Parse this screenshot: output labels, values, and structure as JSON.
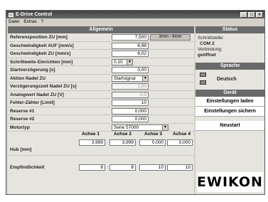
{
  "window": {
    "title": "E-Drive Control"
  },
  "menu": [
    "Datei",
    "Extras",
    "?"
  ],
  "allgemein": {
    "header": "Allgemein",
    "referenzposition": {
      "label": "Referenzposition ZU [mm]",
      "value": "7,500",
      "range": "3mm - 8mm"
    },
    "geschw_auf": {
      "label": "Geschwindigkeit AUF [mm/s]",
      "value": "6,98"
    },
    "geschw_zu": {
      "label": "Geschwindigkeit ZU [mm/s]",
      "value": "6,02"
    },
    "schrittweite": {
      "label": "Schrittweite Einrichten [mm]",
      "value": "0,10"
    },
    "startverz": {
      "label": "Startverzögerung [s]",
      "value": "0,00"
    },
    "aktion": {
      "label": "Aktion Nadel ZU",
      "value": "Startsignal"
    },
    "verzzeit": {
      "label": "Verzögerungszeit Nadel ZU [s]",
      "value": "1,00"
    },
    "analogwert": {
      "label": "Analogwert Nadel ZU [V]",
      "value": "0,0"
    },
    "fehler": {
      "label": "Fehler-Zähler [Limit]",
      "value": "10"
    },
    "reserve1": {
      "label": "Reserve #1",
      "value": "0,000"
    },
    "reserve2": {
      "label": "Reserve #2",
      "value": "0,000"
    },
    "motortyp": {
      "label": "Motortyp",
      "value": "Serie 57000"
    },
    "axes": [
      "Achse 1",
      "Achse 2",
      "Achse 3",
      "Achse 4"
    ],
    "hub": {
      "label": "Hub [mm]",
      "values": [
        "3,999",
        "3,999",
        "0,000",
        "0,000"
      ]
    },
    "empf": {
      "label": "Empfindlichkeit",
      "values": [
        "8",
        "8",
        "10",
        "10"
      ]
    }
  },
  "status": {
    "header": "Status",
    "line1": "Schnittstelle:",
    "line2": "COM 2",
    "line3": "Verbindung:",
    "line4": "geöffnet"
  },
  "sprache": {
    "header": "Sprache",
    "value": "Deutsch"
  },
  "geraet": {
    "header": "Gerät",
    "load": "Einstellungen laden",
    "save": "Einstellungen sichern",
    "restart": "Neustart"
  },
  "logo": "EWIKON"
}
